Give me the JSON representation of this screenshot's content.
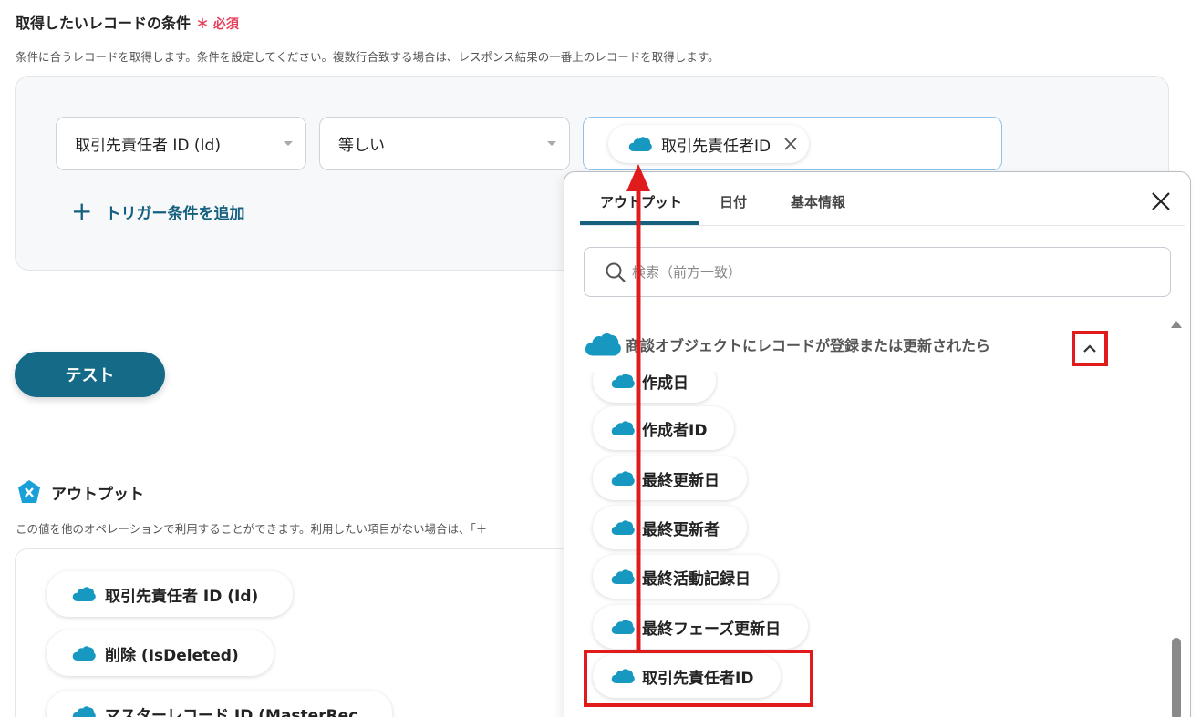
{
  "condition": {
    "title": "取得したいレコードの条件",
    "required_mark": "＊",
    "required_label": "必須",
    "description": "条件に合うレコードを取得します。条件を設定してください。複数行合致する場合は、レスポンス結果の一番上のレコードを取得します。",
    "field_select": "取引先責任者 ID (Id)",
    "operator_select": "等しい",
    "value_chip": "取引先責任者ID",
    "add_trigger": "トリガー条件を追加"
  },
  "test_button": "テスト",
  "output": {
    "title": "アウトプット",
    "description": "この値を他のオペレーションで利用することができます。利用したい項目がない場合は、「＋",
    "items": [
      "取引先責任者 ID (Id)",
      "削除 (IsDeleted)",
      "マスターレコード ID (MasterRec"
    ]
  },
  "panel": {
    "tabs": [
      "アウトプット",
      "日付",
      "基本情報"
    ],
    "search_placeholder": "検索（前方一致）",
    "group_title": "商談オブジェクトにレコードが登録または更新されたら",
    "items": [
      "作成日",
      "作成者ID",
      "最終更新日",
      "最終更新者",
      "最終活動記録日",
      "最終フェーズ更新日",
      "取引先責任者ID"
    ]
  },
  "colors": {
    "accent": "#15607f",
    "salesforce_blue": "#1798c1",
    "highlight_red": "#e01b1b",
    "required_pink": "#e8405a"
  },
  "icons": [
    "salesforce-cloud-icon",
    "plus-icon",
    "close-icon",
    "search-icon",
    "chevron-up-icon",
    "yoom-output-icon",
    "remove-icon"
  ]
}
